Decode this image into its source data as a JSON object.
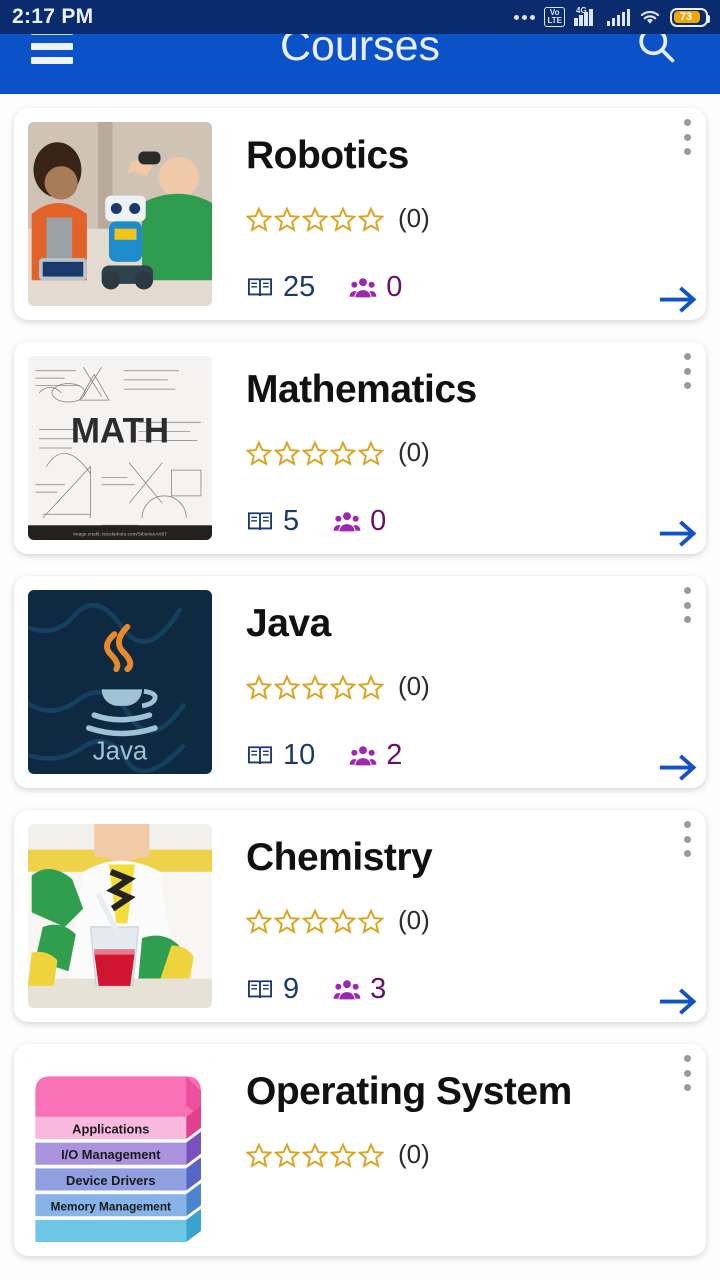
{
  "status_bar": {
    "time": "2:17 PM",
    "battery_level": "73",
    "network_label": "4G",
    "volte_label_top": "Vo",
    "volte_label_bottom": "LTE",
    "icons": [
      "more-dots-icon",
      "volte-icon",
      "signal-4g-icon",
      "signal-icon",
      "wifi-icon",
      "battery-icon"
    ]
  },
  "app_bar": {
    "title": "Courses",
    "menu_icon": "hamburger-menu-icon",
    "search_icon": "search-icon",
    "background_color": "#0b52c9",
    "status_background_color": "#0a2c6e"
  },
  "colors": {
    "star": "#d9a521",
    "lessons": "#1b3a6b",
    "students": "#6a0f6a",
    "arrow": "#1452c4",
    "card_background": "#ffffff",
    "page_background": "#fdfdfd"
  },
  "courses": [
    {
      "title": "Robotics",
      "rating": 0,
      "rating_count": "(0)",
      "lessons": "25",
      "students": "0",
      "thumbnail": "robotics-kids-building-robot-photo",
      "lessons_icon": "book-icon",
      "students_icon": "people-icon",
      "menu_icon": "kebab-menu-icon",
      "arrow_icon": "arrow-right-icon"
    },
    {
      "title": "Mathematics",
      "rating": 0,
      "rating_count": "(0)",
      "lessons": "5",
      "students": "0",
      "thumbnail": "math-equations-chalk-sketch-image",
      "thumbnail_text": "MATH",
      "lessons_icon": "book-icon",
      "students_icon": "people-icon",
      "menu_icon": "kebab-menu-icon",
      "arrow_icon": "arrow-right-icon"
    },
    {
      "title": "Java",
      "rating": 0,
      "rating_count": "(0)",
      "lessons": "10",
      "students": "2",
      "thumbnail": "java-coffee-cup-logo",
      "thumbnail_text": "Java",
      "lessons_icon": "book-icon",
      "students_icon": "people-icon",
      "menu_icon": "kebab-menu-icon",
      "arrow_icon": "arrow-right-icon"
    },
    {
      "title": "Chemistry",
      "rating": 0,
      "rating_count": "(0)",
      "lessons": "9",
      "students": "3",
      "thumbnail": "chemistry-student-beaker-photo",
      "lessons_icon": "book-icon",
      "students_icon": "people-icon",
      "menu_icon": "kebab-menu-icon",
      "arrow_icon": "arrow-right-icon"
    },
    {
      "title": "Operating System",
      "rating": 0,
      "rating_count": "(0)",
      "lessons": "",
      "students": "",
      "thumbnail": "os-layer-stack-diagram",
      "thumbnail_layers": [
        "Applications",
        "I/O Management",
        "Device Drivers",
        "Memory Management"
      ],
      "lessons_icon": "book-icon",
      "students_icon": "people-icon",
      "menu_icon": "kebab-menu-icon",
      "arrow_icon": "arrow-right-icon"
    }
  ]
}
